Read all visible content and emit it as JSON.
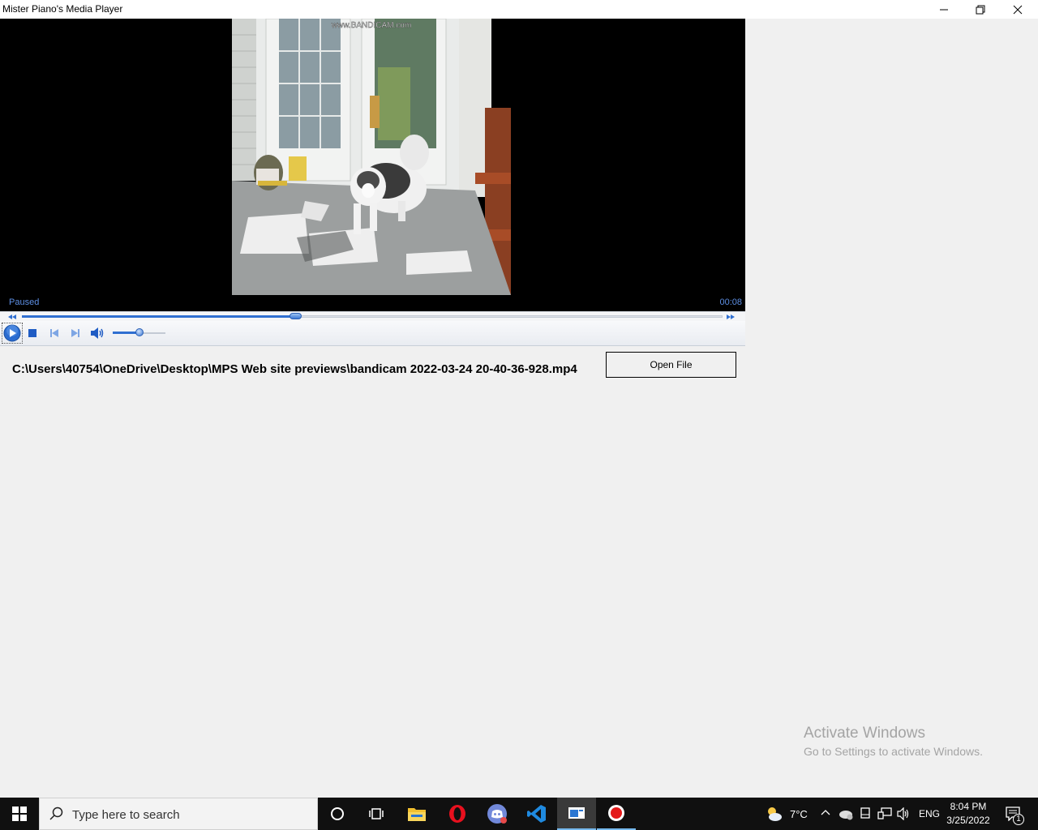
{
  "window": {
    "title": "Mister Piano's Media Player",
    "controls": [
      "minimize",
      "restore",
      "close"
    ]
  },
  "player": {
    "status": "Paused",
    "time": "00:08",
    "video_watermark": "www.BANDICAM.com",
    "seek_progress": 0.39,
    "volume_level": 0.5,
    "buttons": [
      "play-icon",
      "stop-icon",
      "previous-icon",
      "next-icon",
      "volume-icon"
    ]
  },
  "file": {
    "path": "C:\\Users\\40754\\OneDrive\\Desktop\\MPS Web site previews\\bandicam 2022-03-24 20-40-36-928.mp4",
    "open_label": "Open File"
  },
  "activation": {
    "title": "Activate Windows",
    "subtitle": "Go to Settings to activate Windows."
  },
  "taskbar": {
    "search_placeholder": "Type here to search",
    "apps": [
      "cortana-icon",
      "task-view-icon",
      "file-explorer-icon",
      "opera-icon",
      "discord-icon",
      "vscode-icon",
      "media-player-icon",
      "bandicam-icon"
    ],
    "weather": "7°C",
    "language": "ENG",
    "time": "8:04 PM",
    "date": "3/25/2022",
    "notifications": "1"
  }
}
